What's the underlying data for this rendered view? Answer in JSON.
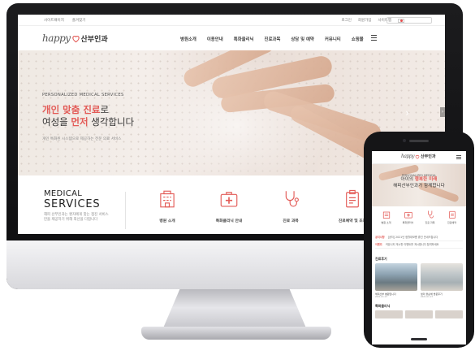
{
  "desktop": {
    "util": {
      "left_links": [
        "사이트패이지",
        "즐겨찾기"
      ],
      "right_links": [
        "로그인",
        "회원가입",
        "사이트맵"
      ]
    },
    "logo": {
      "happy": "happy",
      "name": "산부인과"
    },
    "nav": [
      "병원소개",
      "이용안내",
      "특화클리닉",
      "진료과목",
      "상담 및 예약",
      "커뮤니티",
      "쇼핑몰"
    ],
    "hero": {
      "eyebrow": "PERSONALIZED MEDICAL SERVICES",
      "line1_accent": "개인 맞춤 진료",
      "line1_rest": "로",
      "line2_pre": "여성을 ",
      "line2_accent": "먼저",
      "line2_rest": " 생각합니다",
      "sub": "개인 특화된 시스템으로 제공하는 전문 의료 서비스"
    },
    "services": {
      "title_top": "MEDICAL",
      "title_bottom": "SERVICES",
      "desc": "해피 산부인과는 환자에게 맞는 점진 서비스만을 제공하기 위해 최선을 다합니다",
      "items": [
        {
          "label": "병원 소개"
        },
        {
          "label": "특화클리닉 안내"
        },
        {
          "label": "진료 과목"
        },
        {
          "label": "진료예약 및 조회"
        }
      ]
    }
  },
  "mobile": {
    "logo": {
      "happy": "happy",
      "name": "산부인과"
    },
    "hero": {
      "eyebrow": "PERSONALIZED MEDICAL",
      "line1_pre": "아이의 ",
      "line1_accent": "행복한 미래",
      "line2": "해피산부인과가 함께합니다"
    },
    "icons": [
      {
        "label": "병원 소개"
      },
      {
        "label": "특화클리닉"
      },
      {
        "label": "진료 과목"
      },
      {
        "label": "진료예약"
      }
    ],
    "notices": [
      {
        "tag": "공지사항",
        "text": "[공지] 2021년 정월대보름 휴진 안내드립니다"
      },
      {
        "tag": "이벤트",
        "text": "커뮤니티 게시판 이벤트를 게시합니다 참여하세요"
      }
    ],
    "blog_title": "진료후기",
    "blog": [
      {
        "caption": "해피산부 병원입니다",
        "meta": "2021.01.13"
      },
      {
        "caption": "생리 불순해 방문후기",
        "meta": "2021.01.13"
      }
    ],
    "clinic_title": "특화클리닉"
  },
  "colors": {
    "accent": "#e35b57",
    "text": "#333333",
    "device": "#151517"
  }
}
